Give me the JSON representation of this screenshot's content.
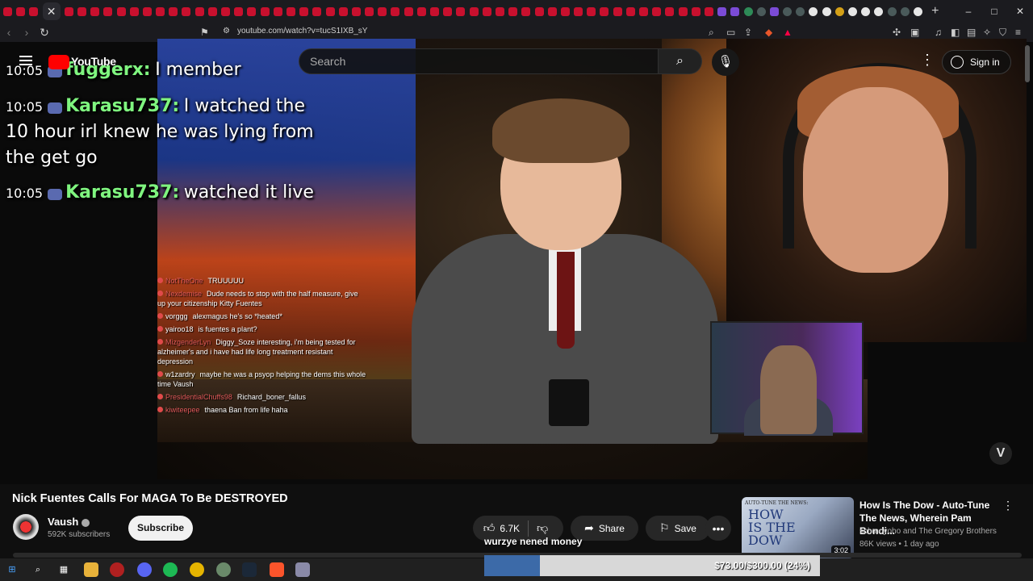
{
  "browser": {
    "url": "youtube.com/watch?v=tucS1IXB_sY",
    "new_tab": "+",
    "window_controls": [
      "–",
      "□",
      "✕"
    ]
  },
  "youtube": {
    "logo_text": "YouTube",
    "search_placeholder": "Search",
    "sign_in": "Sign in"
  },
  "overlay_chat": [
    {
      "time": "10:05",
      "user": "fuggerx:",
      "message": "I member"
    },
    {
      "time": "10:05",
      "user": "Karasu737:",
      "message": "I watched the 10 hour irl knew he was lying from the get go"
    },
    {
      "time": "10:05",
      "user": "Karasu737:",
      "message": "watched it live"
    }
  ],
  "embedded_chat": [
    {
      "user": "NotTheOne",
      "message": "TRUUUUU"
    },
    {
      "user": "Nexdemise",
      "message": "Dude needs to stop with the half measure, give up your citizenship Kitty Fuentes"
    },
    {
      "user": "vorggg",
      "message": "alexmagus he's so *heated*"
    },
    {
      "user": "yairoo18",
      "message": "is fuentes a plant?"
    },
    {
      "user": "MizgenderLyn",
      "message": "Diggy_Soze interesting, i'm being tested for alzheimer's and i have had life long treatment resistant depression"
    },
    {
      "user": "w1zardry",
      "message": "maybe he was a psyop helping the dems this whole time Vaush"
    },
    {
      "user": "PresidentialChuffs98",
      "message": "Richard_boner_fallus"
    },
    {
      "user": "kiwiteepee",
      "message": "thaena Ban from life haha"
    }
  ],
  "video": {
    "title": "Nick Fuentes Calls For MAGA To Be DESTROYED",
    "channel": "Vaush",
    "subscribers": "592K subscribers",
    "subscribe_label": "Subscribe",
    "likes": "6.7K",
    "share_label": "Share",
    "save_label": "Save",
    "caption": "wurzye nened money",
    "watermark": "V"
  },
  "recommendation": {
    "thumb_small": "AUTO-TUNE THE NEWS:",
    "thumb_big": "HOW IS THE DOW",
    "duration": "3:02",
    "title": "How Is The Dow - Auto-Tune The News, Wherein Pam Bondi...",
    "channel": "schmoyoho and The Gregory Brothers",
    "meta": "86K views • 1 day ago"
  },
  "goal": {
    "text": "$73.00/$300.00 (24%)",
    "progress": 0.24,
    "fill_color": "#3c6aa8"
  }
}
